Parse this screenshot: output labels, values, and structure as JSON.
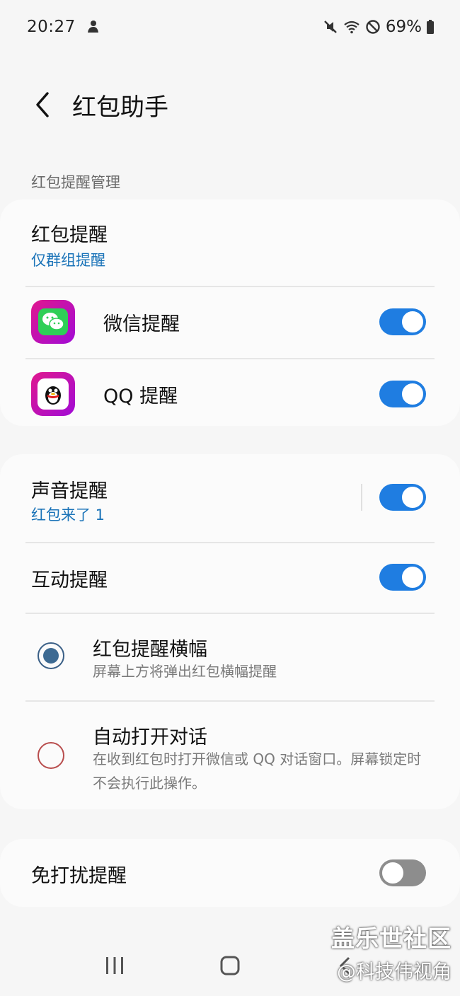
{
  "status_bar": {
    "time": "20:27",
    "battery": "69%"
  },
  "header": {
    "title": "红包助手"
  },
  "section_label": "红包提醒管理",
  "red_packet_alert": {
    "title": "红包提醒",
    "subtitle": "仅群组提醒"
  },
  "apps": [
    {
      "label": "微信提醒",
      "enabled": true,
      "icon": "wechat-icon"
    },
    {
      "label": "QQ 提醒",
      "enabled": true,
      "icon": "qq-icon"
    }
  ],
  "sound_alert": {
    "title": "声音提醒",
    "subtitle": "红包来了 1",
    "enabled": true
  },
  "interaction_alert": {
    "title": "互动提醒",
    "enabled": true
  },
  "options": [
    {
      "title": "红包提醒横幅",
      "desc": "屏幕上方将弹出红包横幅提醒",
      "selected": true
    },
    {
      "title": "自动打开对话",
      "desc": "在收到红包时打开微信或 QQ 对话窗口。屏幕锁定时不会执行此操作。",
      "selected": false
    }
  ],
  "dnd_alert": {
    "title": "免打扰提醒",
    "enabled": false
  },
  "watermark": {
    "line1": "盖乐世社区",
    "line2": "@科技伟视角"
  },
  "colors": {
    "accent": "#1f7de1",
    "link": "#1a73b8",
    "background": "#f6f6f6"
  }
}
